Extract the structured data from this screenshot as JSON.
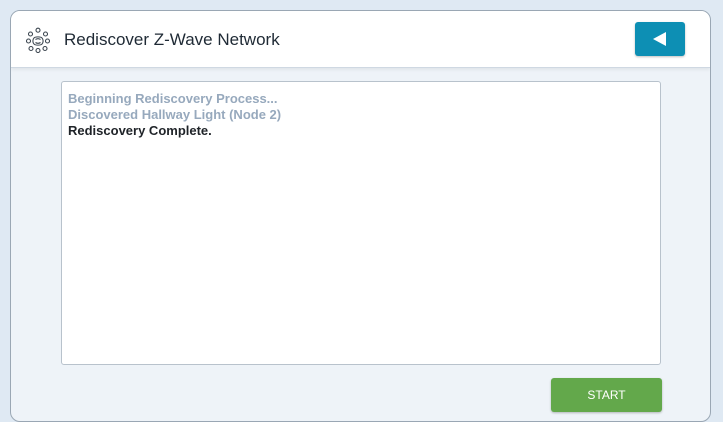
{
  "header": {
    "title": "Rediscover Z-Wave Network",
    "icon": "network-nodes-icon",
    "back_icon": "back-arrow-icon"
  },
  "log": {
    "lines": [
      {
        "text": "Beginning Rediscovery Process...",
        "state": "faded"
      },
      {
        "text": "Discovered Hallway Light (Node 2)",
        "state": "faded"
      },
      {
        "text": "Rediscovery Complete.",
        "state": "current"
      }
    ]
  },
  "actions": {
    "start_label": "START"
  },
  "colors": {
    "back_button": "#0d8fb4",
    "start_button": "#63a84b",
    "faded_text": "#97a9bd",
    "current_text": "#1f2328"
  }
}
